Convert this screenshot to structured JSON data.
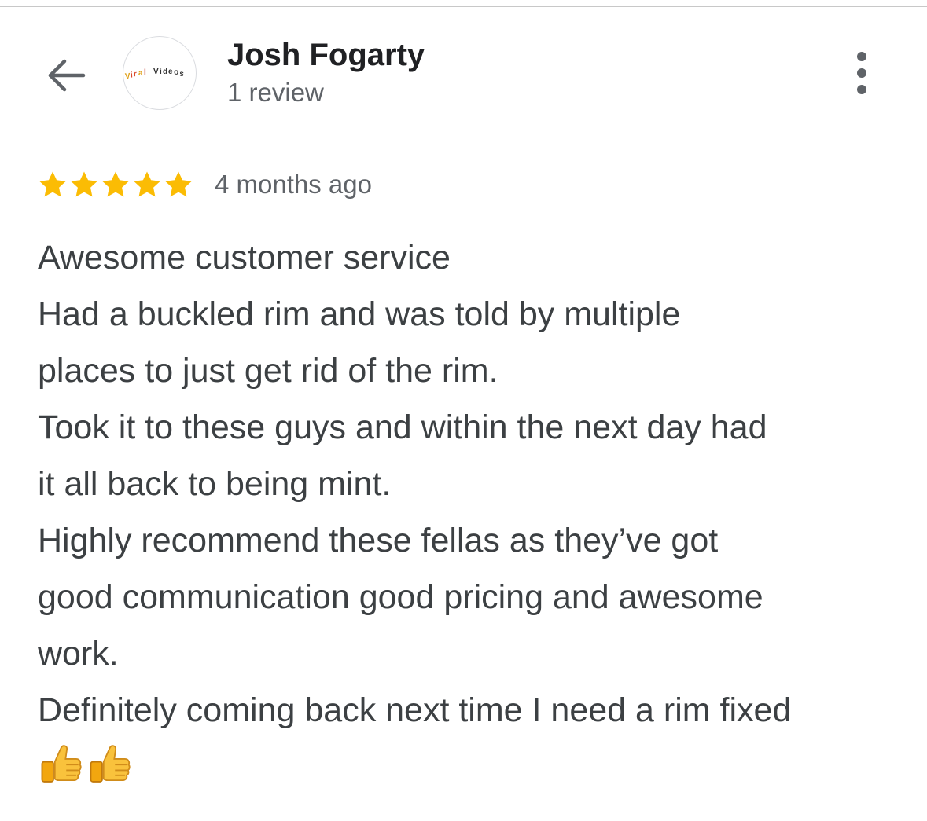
{
  "header": {
    "back_icon": "arrow-back-icon",
    "more_icon": "more-vertical-icon"
  },
  "reviewer": {
    "name": "Josh Fogarty",
    "review_count": "1 review",
    "avatar_text": "Viral Videos"
  },
  "review": {
    "rating": 5,
    "max_rating": 5,
    "star_color": "#fbbc04",
    "date": "4 months ago",
    "lines": [
      "Awesome customer service",
      "Had a buckled rim and was told by multiple",
      "places to just get rid of the rim.",
      "Took it to these guys and within the next day had",
      "it all back to being mint.",
      "Highly recommend these fellas as they’ve got",
      "good communication good pricing and awesome",
      "work.",
      "Definitely coming back next time I need a rim fixed"
    ],
    "emojis": [
      "thumbs-up-emoji",
      "thumbs-up-emoji"
    ]
  }
}
